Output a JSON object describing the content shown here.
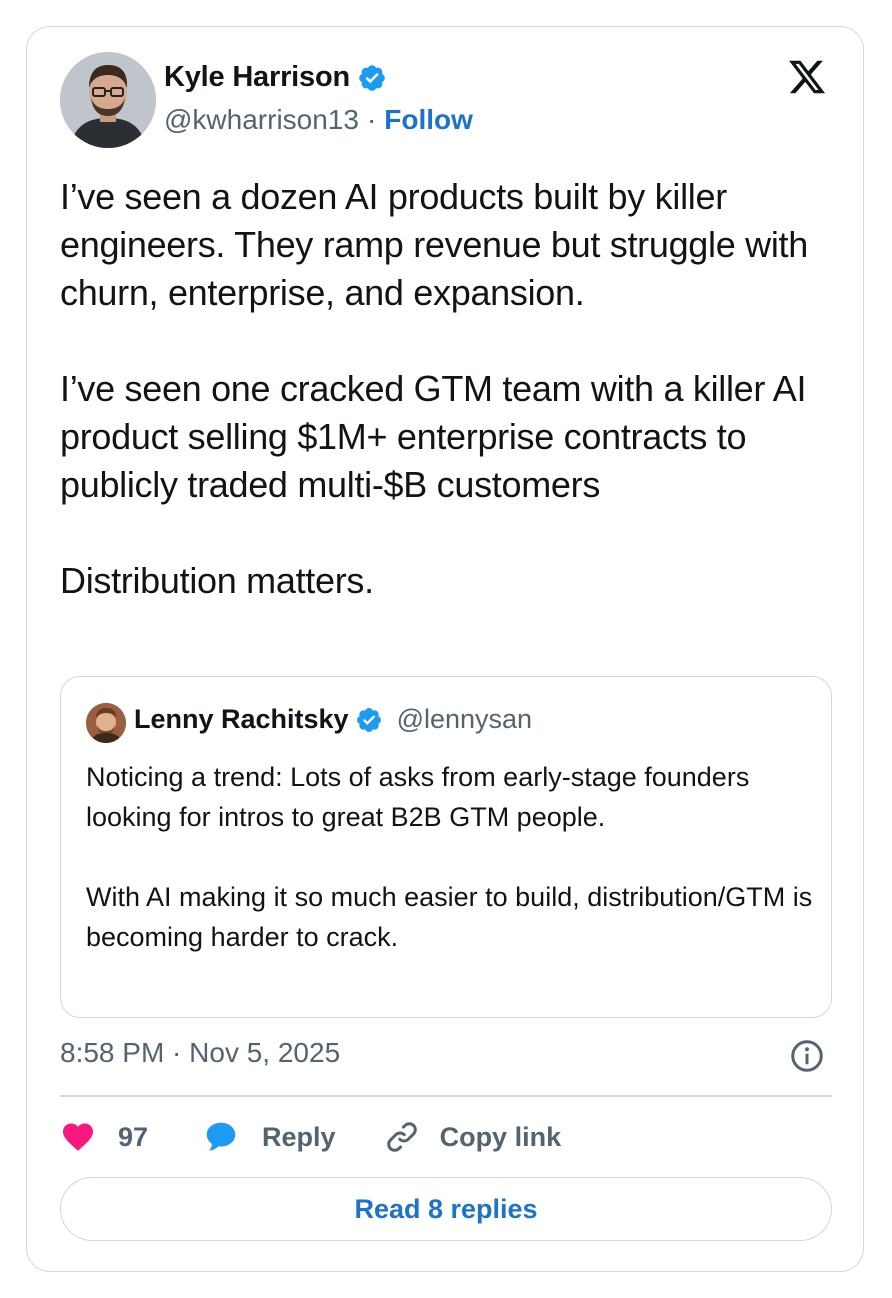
{
  "author": {
    "name": "Kyle Harrison",
    "handle": "@kwharrison13",
    "separator": "·",
    "follow_label": "Follow"
  },
  "tweet": {
    "text": "I’ve seen a dozen AI products built by killer engineers. They ramp revenue but struggle with churn, enterprise, and expansion.\n\nI’ve seen one cracked GTM team with a killer AI product selling $1M+ enterprise contracts to publicly traded multi-$B customers\n\nDistribution matters."
  },
  "quoted_tweet": {
    "name": "Lenny Rachitsky",
    "handle": "@lennysan",
    "text": "Noticing a trend: Lots of asks from early-stage founders looking for intros to great B2B GTM people.\n\nWith AI making it so much easier to build, distribution/GTM is becoming harder to crack."
  },
  "meta": {
    "timestamp": "8:58 PM · Nov 5, 2025"
  },
  "actions": {
    "like_count": "97",
    "reply_label": "Reply",
    "copy_link_label": "Copy link",
    "read_replies_label": "Read 8 replies"
  },
  "icons": {
    "brand": "x-logo-icon",
    "verified": "verified-badge-icon",
    "like": "heart-icon",
    "reply": "speech-bubble-icon",
    "copy": "link-icon",
    "info": "info-icon"
  },
  "colors": {
    "accent": "#1d72c9",
    "verified": "#1d9bf0",
    "like": "#f91880",
    "secondary_text": "#536471",
    "border": "#cfd9de"
  }
}
